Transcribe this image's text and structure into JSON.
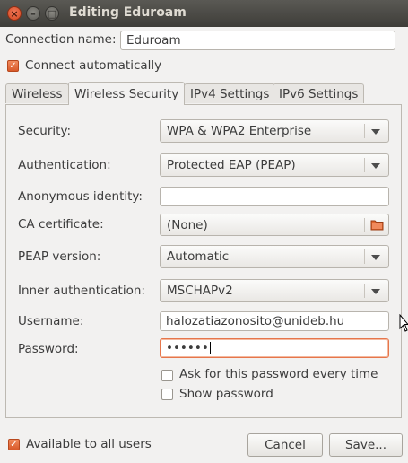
{
  "window": {
    "title": "Editing Eduroam",
    "close_glyph": "×",
    "min_glyph": "–",
    "max_glyph": "□"
  },
  "connection": {
    "name_label": "Connection name:",
    "name_value": "Eduroam",
    "connect_auto_label": "Connect automatically",
    "connect_auto_checked": true
  },
  "tabs": [
    {
      "label": "Wireless"
    },
    {
      "label": "Wireless Security"
    },
    {
      "label": "IPv4 Settings"
    },
    {
      "label": "IPv6 Settings"
    }
  ],
  "active_tab": "Wireless Security",
  "security": {
    "security_label": "Security:",
    "security_value": "WPA & WPA2 Enterprise",
    "auth_label": "Authentication:",
    "auth_value": "Protected EAP (PEAP)",
    "anon_label": "Anonymous identity:",
    "anon_value": "",
    "ca_label": "CA certificate:",
    "ca_value": "(None)",
    "ca_icon": "folder-icon",
    "peap_label": "PEAP version:",
    "peap_value": "Automatic",
    "inner_label": "Inner authentication:",
    "inner_value": "MSCHAPv2",
    "username_label": "Username:",
    "username_value": "halozatiazonosito@unideb.hu",
    "password_label": "Password:",
    "password_value": "••••••",
    "ask_password_label": "Ask for this password every time",
    "ask_password_checked": false,
    "show_password_label": "Show password",
    "show_password_checked": false
  },
  "footer": {
    "available_label": "Available to all users",
    "available_checked": true,
    "cancel_label": "Cancel",
    "save_label": "Save..."
  },
  "colors": {
    "titlebar": "#3e3d39",
    "accent": "#dd4814",
    "background": "#f2f1f0"
  }
}
